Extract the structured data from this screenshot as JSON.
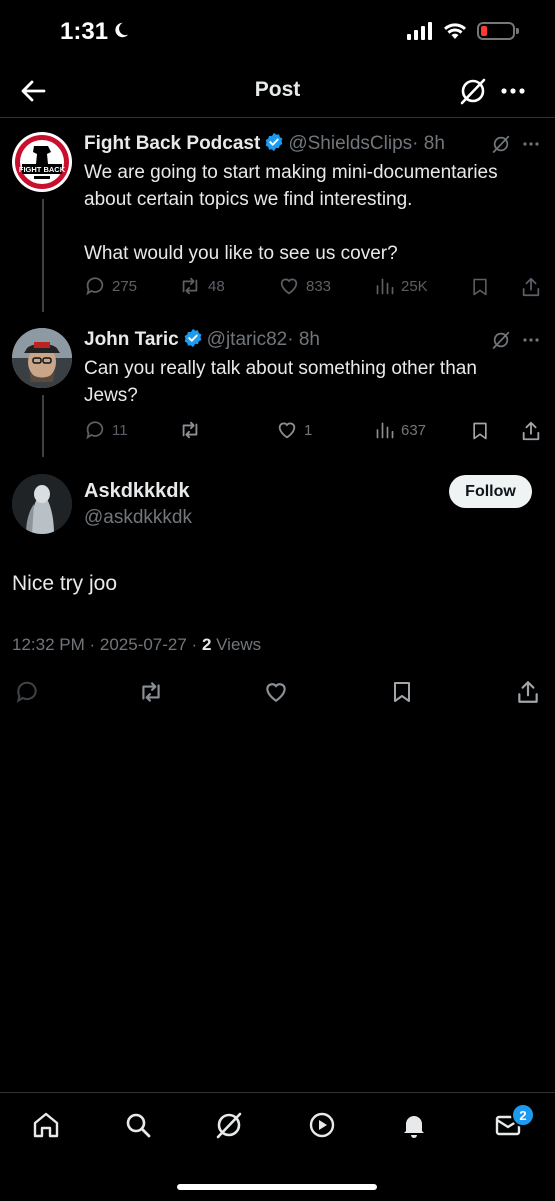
{
  "status_bar": {
    "time": "1:31"
  },
  "header": {
    "title": "Post"
  },
  "thread": [
    {
      "name": "Fight Back Podcast",
      "handle": "@ShieldsClips",
      "time": "· 8h",
      "text_lines": [
        "We are going to start making mini-documentaries",
        "about certain topics we find interesting."
      ],
      "text_line2": "What would you like to see us cover?",
      "avatar_text": "FIGHT BACK",
      "replies": "275",
      "reposts": "48",
      "likes": "833",
      "views": "25K"
    },
    {
      "name": "John Taric",
      "handle": "@jtaric82",
      "time": "· 8h",
      "text_lines": [
        "Can you really talk about something other than",
        "Jews?"
      ],
      "replies": "11",
      "reposts": "",
      "likes": "1",
      "views": "637"
    }
  ],
  "main_post": {
    "name": "Askdkkkdk",
    "handle": "@askdkkkdk",
    "follow_label": "Follow",
    "text": "Nice try joo",
    "timestamp": "12:32 PM · 2025-07-27 · ",
    "views_count": "2",
    "views_label": " Views"
  },
  "tab_bar": {
    "items": [
      "home-icon",
      "search-icon",
      "grok-icon",
      "video-icon",
      "notifications-icon",
      "messages-icon"
    ],
    "messages_badge": "2"
  },
  "colors": {
    "accent": "#1d9bf0",
    "background": "#000000",
    "muted": "#71767b"
  }
}
